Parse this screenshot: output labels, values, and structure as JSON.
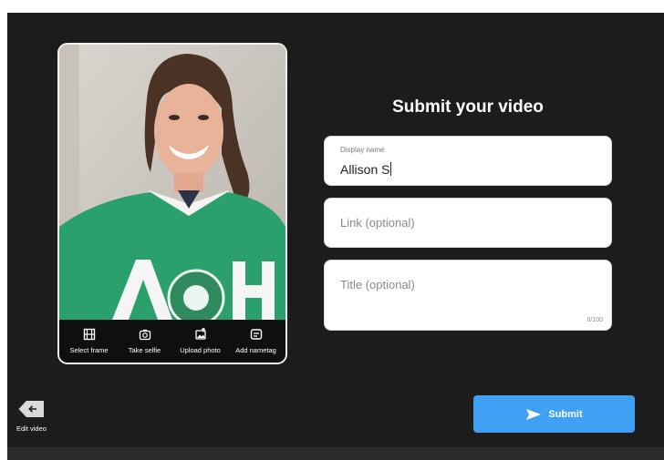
{
  "title": "Submit your video",
  "photo_toolbar": {
    "select_frame": "Select frame",
    "take_selfie": "Take selfie",
    "upload_photo": "Upload photo",
    "add_nametag": "Add nametag"
  },
  "fields": {
    "display_name": {
      "label": "Display name",
      "value": "Allison S"
    },
    "link": {
      "placeholder": "Link (optional)"
    },
    "title": {
      "placeholder": "Title (optional)",
      "counter": "0/100"
    }
  },
  "edit_video": {
    "label": "Edit video"
  },
  "submit": {
    "label": "Submit"
  },
  "colors": {
    "background": "#1c1c1c",
    "submit": "#3fa0f4",
    "sweater": "#2aa06d"
  },
  "icons": {
    "select_frame": "film-icon",
    "take_selfie": "camera-icon",
    "upload_photo": "image-upload-icon",
    "add_nametag": "nametag-icon",
    "edit_video": "back-arrow-icon",
    "submit": "send-icon"
  }
}
